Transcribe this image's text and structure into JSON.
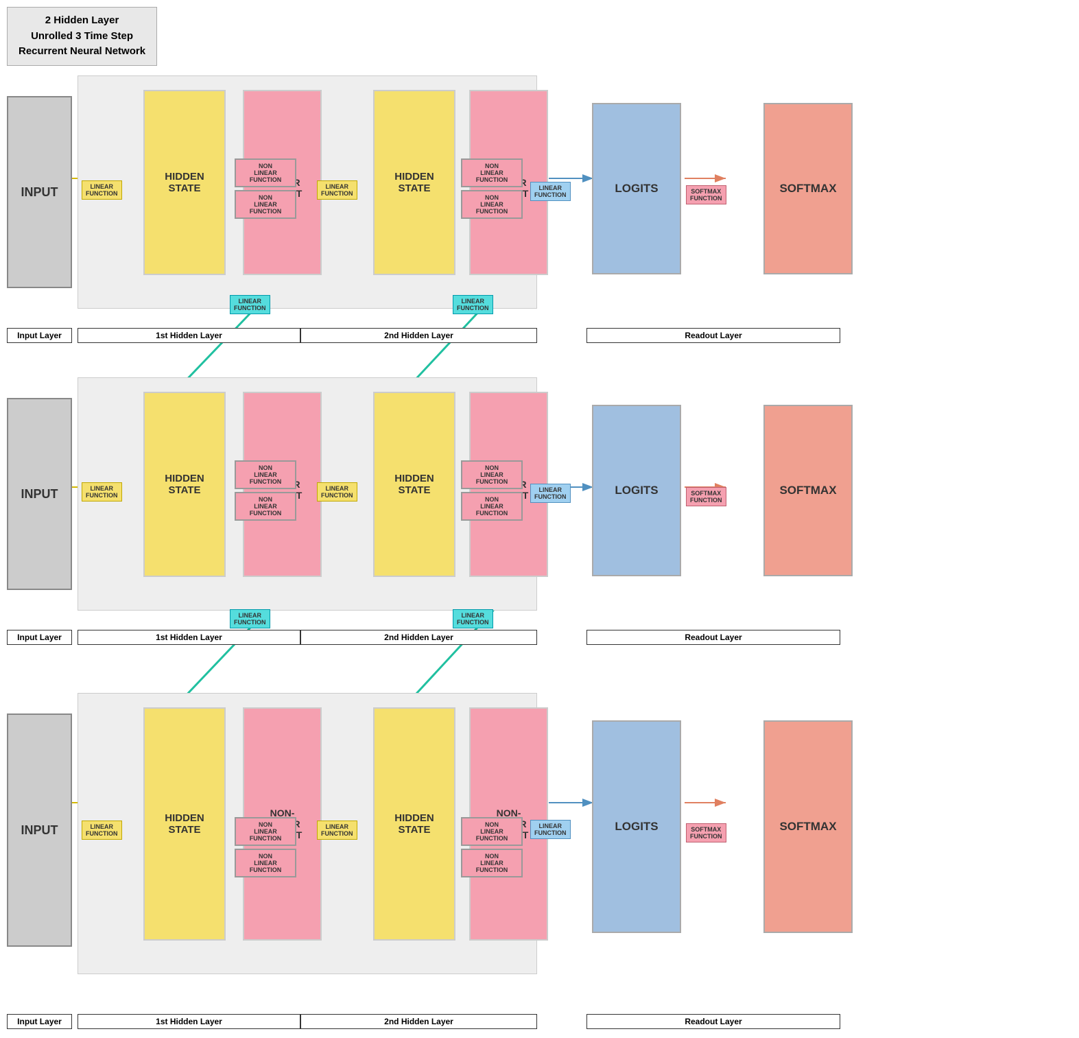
{
  "title": {
    "line1": "2 Hidden Layer",
    "line2": "Unrolled 3 Time Step",
    "line3": "Recurrent Neural Network"
  },
  "rows": [
    {
      "id": "row1",
      "input_label": "INPUT",
      "input_layer_label": "Input Layer",
      "hidden_state_label": "HIDDEN\nSTATE",
      "nonlinear_output_label": "NON-\nLINEAR\nOUTPUT",
      "nl_func_label": "NON\nLINEAR\nFUNCTION",
      "linear_function_label": "LINEAR\nFUNCTION",
      "layer1_label": "1st Hidden Layer",
      "layer2_label": "2nd Hidden Layer",
      "logits_label": "LOGITS",
      "softmax_label": "SOFTMAX",
      "linear_func_readout": "LINEAR\nFUNCTION",
      "softmax_func_label": "SOFTMAX\nFUNCTION",
      "readout_label": "Readout Layer"
    },
    {
      "id": "row2",
      "input_label": "INPUT",
      "input_layer_label": "Input Layer",
      "hidden_state_label": "HIDDEN\nSTATE",
      "nonlinear_output_label": "NON-\nLINEAR\nOUTPUT",
      "nl_func_label": "NON\nLINEAR\nFUNCTION",
      "linear_function_label": "LINEAR\nFUNCTION",
      "layer1_label": "1st Hidden Layer",
      "layer2_label": "2nd Hidden Layer",
      "logits_label": "LOGITS",
      "softmax_label": "SOFTMAX",
      "linear_func_readout": "LINEAR\nFUNCTION",
      "softmax_func_label": "SOFTMAX\nFUNCTION",
      "readout_label": "Readout Layer"
    },
    {
      "id": "row3",
      "input_label": "INPUT",
      "input_layer_label": "Input Layer",
      "hidden_state_label": "HIDDEN\nSTATE",
      "nonlinear_output_label": "NON-\nLINEAR\nOUTPUT",
      "nl_func_label": "NON\nLINEAR\nFUNCTION",
      "linear_function_label": "LINEAR\nFUNCTION",
      "layer1_label": "1st Hidden Layer",
      "layer2_label": "2nd Hidden Layer",
      "logits_label": "LOGITS",
      "softmax_label": "SOFTMAX",
      "linear_func_readout": "LINEAR\nFUNCTION",
      "softmax_func_label": "SOFTMAX\nFUNCTION",
      "readout_label": "Readout Layer"
    }
  ],
  "between_arrows": [
    {
      "label1": "LINEAR\nFUNCTION",
      "label2": "LINEAR\nFUNCTION"
    },
    {
      "label1": "LINEAR\nFUNCTION",
      "label2": "LINEAR\nFUNCTION"
    }
  ]
}
